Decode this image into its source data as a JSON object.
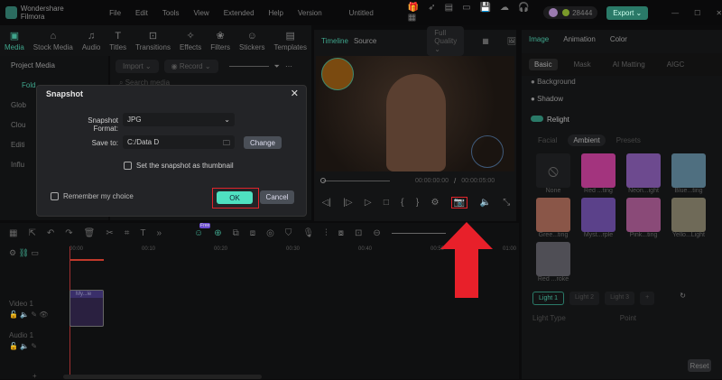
{
  "app": {
    "name": "Wondershare Filmora",
    "title": "Untitled",
    "menu": [
      "File",
      "Edit",
      "Tools",
      "View",
      "Extended",
      "Help",
      "Version"
    ],
    "credits": "28444",
    "export": "Export"
  },
  "toolbar": [
    "Media",
    "Stock Media",
    "Audio",
    "Titles",
    "Transitions",
    "Effects",
    "Filters",
    "Stickers",
    "Templates"
  ],
  "leftnav": [
    "Project Media",
    "Fold",
    "Glob",
    "Clou",
    "Editi",
    "Influ"
  ],
  "media": {
    "import": "Import",
    "record": "Record",
    "search_placeholder": "Search media"
  },
  "player": {
    "tab_timeline": "Timeline",
    "tab_source": "Source",
    "quality": "Full Quality",
    "time_current": "00:00:00:00",
    "time_sep": "/",
    "time_total": "00:00:05:00"
  },
  "right": {
    "tabs": [
      "Image",
      "Animation",
      "Color"
    ],
    "subtabs": [
      "Basic",
      "Mask",
      "AI Matting",
      "AIGC"
    ],
    "background": "Background",
    "shadow": "Shadow",
    "relight": "Relight",
    "modes": [
      "Facial",
      "Ambient",
      "Presets"
    ],
    "presets": [
      {
        "label": "None",
        "color": "#1a1b1d"
      },
      {
        "label": "Red ...ting",
        "color": "#a3347e"
      },
      {
        "label": "Neon...ight",
        "color": "#6d4a8f"
      },
      {
        "label": "Blue...ting",
        "color": "#4f6f80"
      },
      {
        "label": "Gree...ting",
        "color": "#8a5648"
      },
      {
        "label": "Myst...rple",
        "color": "#5b418a"
      },
      {
        "label": "Pink...ting",
        "color": "#8a4a78"
      },
      {
        "label": "Yello...Light",
        "color": "#6f6a58"
      },
      {
        "label": "Red ...roke",
        "color": "#4f4e55"
      }
    ],
    "lights": [
      "Light 1",
      "Light 2",
      "Light 3",
      "+"
    ],
    "light_type": "Light Type",
    "point": "Point",
    "reset": "Reset"
  },
  "timeline": {
    "ticks": [
      "00:00",
      "00:10",
      "00:20",
      "00:30",
      "00:40",
      "00:50",
      "01:00"
    ],
    "video_track": "Video 1",
    "audio_track": "Audio 1",
    "clip": "My...ie",
    "badge": "Free"
  },
  "dialog": {
    "title": "Snapshot",
    "format_label": "Snapshot Format:",
    "format_value": "JPG",
    "save_label": "Save to:",
    "save_value": "C:/Data D",
    "change": "Change",
    "thumbnail": "Set the snapshot as thumbnail",
    "remember": "Remember my choice",
    "ok": "OK",
    "cancel": "Cancel"
  },
  "colors": {
    "accent": "#4fe0c0",
    "highlight": "#e0242b"
  }
}
